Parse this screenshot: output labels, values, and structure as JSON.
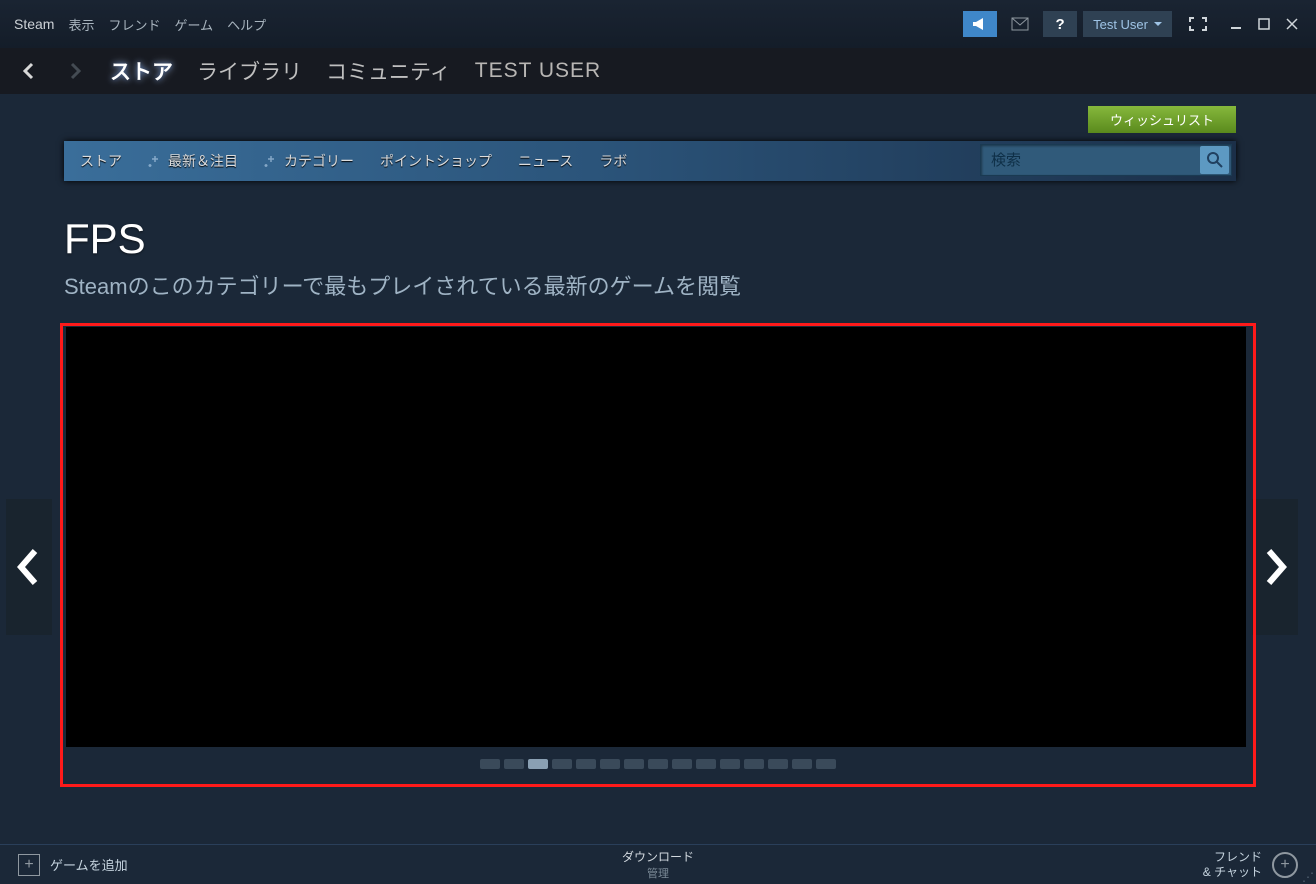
{
  "titlebar": {
    "app_name": "Steam",
    "menu": [
      "表示",
      "フレンド",
      "ゲーム",
      "ヘルプ"
    ],
    "user_name": "Test User"
  },
  "nav": {
    "items": [
      "ストア",
      "ライブラリ",
      "コミュニティ"
    ],
    "active_index": 0,
    "user_label": "TEST USER"
  },
  "wishlist_label": "ウィッシュリスト",
  "storebar": {
    "items": [
      "ストア",
      "最新＆注目",
      "カテゴリー",
      "ポイントショップ",
      "ニュース",
      "ラボ"
    ],
    "search_placeholder": "検索"
  },
  "page": {
    "title": "FPS",
    "subtitle": "Steamのこのカテゴリーで最もプレイされている最新のゲームを閲覧"
  },
  "carousel": {
    "page_count": 15,
    "active_index": 2
  },
  "bottom": {
    "add_game": "ゲームを追加",
    "downloads": "ダウンロード",
    "downloads_sub": "管理",
    "friends_line1": "フレンド",
    "friends_line2": "& チャット"
  }
}
